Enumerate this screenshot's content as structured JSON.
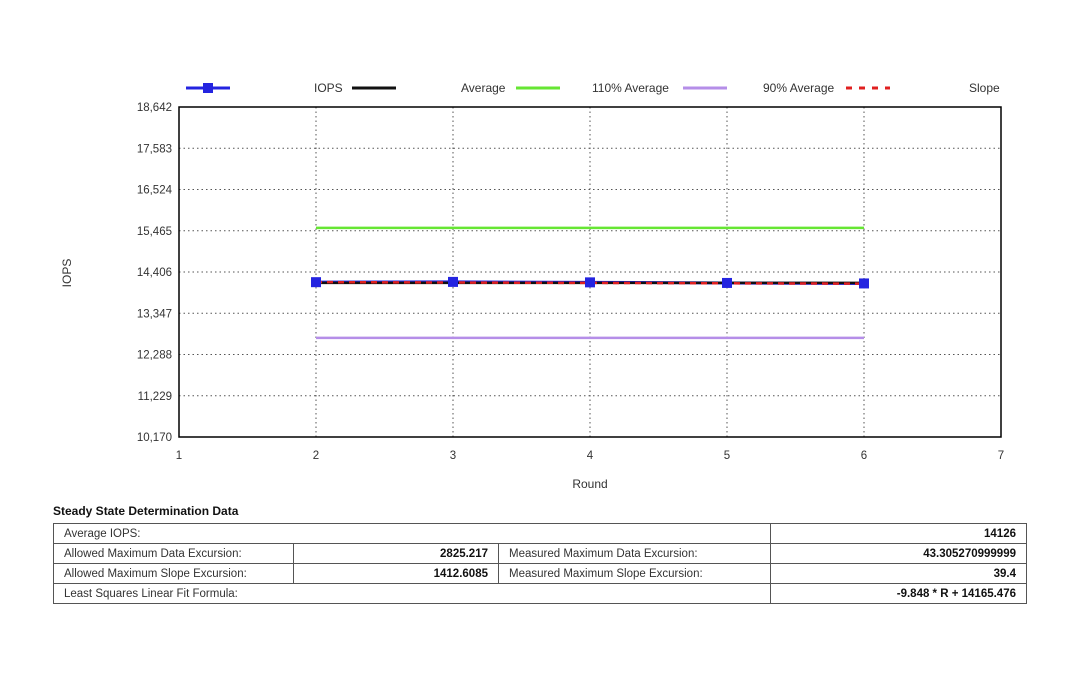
{
  "chart_data": {
    "type": "line",
    "xlabel": "Round",
    "ylabel": "IOPS",
    "xlim": [
      1,
      7
    ],
    "ylim": [
      10170,
      18642
    ],
    "x_ticks": [
      "1",
      "2",
      "3",
      "4",
      "5",
      "6",
      "7"
    ],
    "y_ticks": [
      "10,170",
      "11,229",
      "12,288",
      "13,347",
      "14,406",
      "15,465",
      "16,524",
      "17,583",
      "18,642"
    ],
    "grid": true,
    "legend_position": "top",
    "legend": [
      "IOPS",
      "Average",
      "110% Average",
      "90% Average",
      "Slope"
    ],
    "x": [
      2,
      3,
      4,
      5,
      6
    ],
    "series": [
      {
        "name": "IOPS",
        "values": [
          14145,
          14152,
          14140,
          14125,
          14112
        ],
        "color": "#2424e0"
      },
      {
        "name": "Average",
        "values": [
          14126,
          14126,
          14126,
          14126,
          14126
        ],
        "color": "#111111"
      },
      {
        "name": "110% Average",
        "values": [
          15538.6,
          15538.6,
          15538.6,
          15538.6,
          15538.6
        ],
        "color": "#66e633"
      },
      {
        "name": "90% Average",
        "values": [
          12713.4,
          12713.4,
          12713.4,
          12713.4,
          12713.4
        ],
        "color": "#b58ee8"
      },
      {
        "name": "Slope",
        "values": [
          14145.78,
          14135.93,
          14126.08,
          14116.24,
          14106.39
        ],
        "color": "#e02020"
      }
    ]
  },
  "table": {
    "title": "Steady State Determination Data",
    "average_label": "Average IOPS:",
    "average_value": "14126",
    "allowed_data_label": "Allowed Maximum Data Excursion:",
    "allowed_data_value": "2825.217",
    "measured_data_label": "Measured Maximum Data Excursion:",
    "measured_data_value": "43.305270999999",
    "allowed_slope_label": "Allowed Maximum Slope Excursion:",
    "allowed_slope_value": "1412.6085",
    "measured_slope_label": "Measured Maximum Slope Excursion:",
    "measured_slope_value": "39.4",
    "fit_label": "Least Squares Linear Fit Formula:",
    "fit_value": "-9.848 * R + 14165.476"
  }
}
